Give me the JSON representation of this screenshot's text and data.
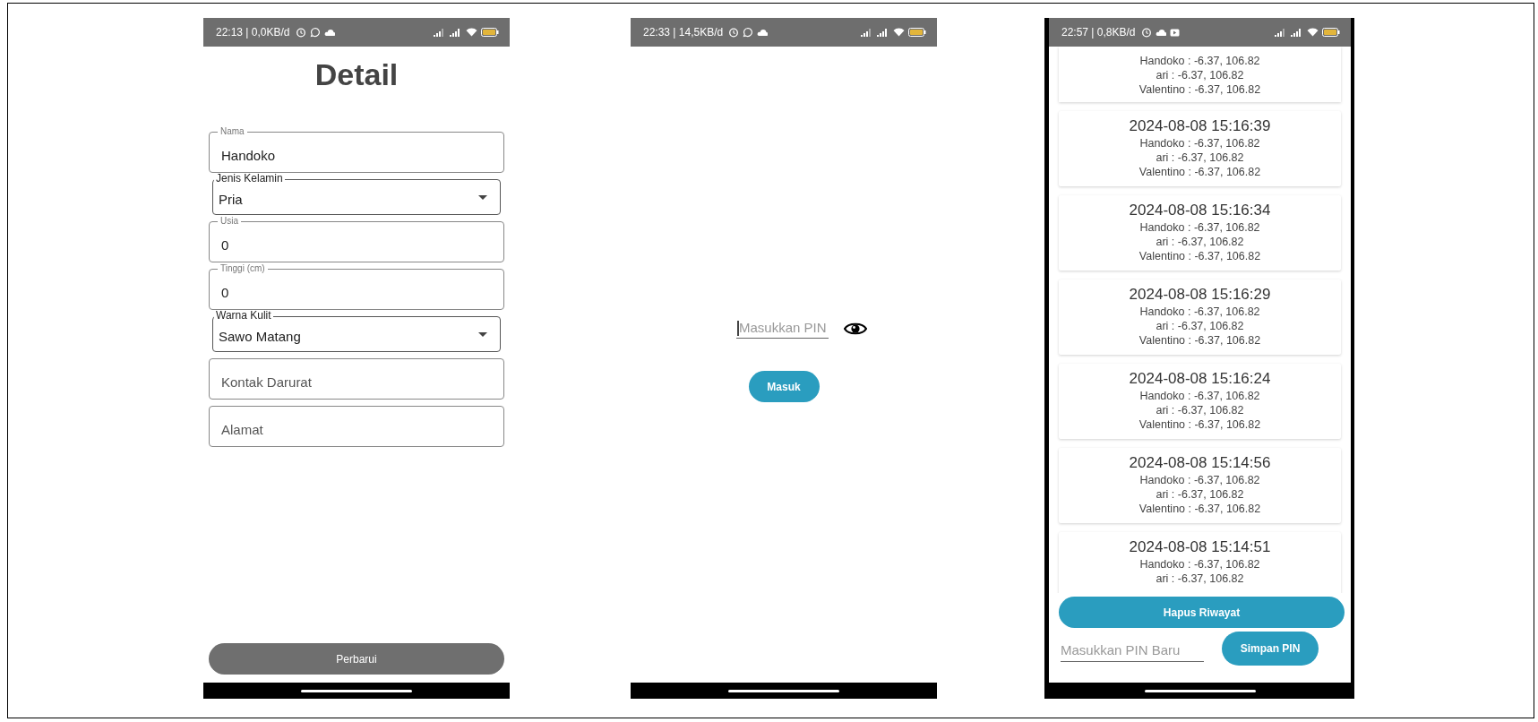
{
  "screens": [
    {
      "kind": "detail",
      "status_bar": {
        "text": "22:13 | 0,0KB/d"
      },
      "title": "Detail",
      "fields": [
        {
          "kind": "text",
          "label": "Nama",
          "value": "Handoko"
        },
        {
          "kind": "dropdown",
          "label": "Jenis Kelamin",
          "value": "Pria"
        },
        {
          "kind": "text",
          "label": "Usia",
          "value": "0"
        },
        {
          "kind": "text",
          "label": "Tinggi (cm)",
          "value": "0"
        },
        {
          "kind": "dropdown",
          "label": "Warna Kulit",
          "value": "Sawo Matang"
        },
        {
          "kind": "text",
          "placeholder": "Kontak Darurat"
        },
        {
          "kind": "text",
          "placeholder": "Alamat"
        }
      ],
      "button": "Perbarui"
    },
    {
      "kind": "pin",
      "status_bar": {
        "text": "22:33 | 14,5KB/d"
      },
      "pin_field": {
        "placeholder": "Masukkan PIN",
        "focused": true
      },
      "button": "Masuk"
    },
    {
      "kind": "history",
      "status_bar": {
        "text": "22:57 | 0,8KB/d"
      },
      "entries": [
        {
          "lines": [
            "Handoko : -6.37, 106.82",
            "ari : -6.37, 106.82",
            "Valentino : -6.37, 106.82"
          ]
        },
        {
          "time": "2024-08-08 15:16:39",
          "lines": [
            "Handoko : -6.37, 106.82",
            "ari : -6.37, 106.82",
            "Valentino : -6.37, 106.82"
          ]
        },
        {
          "time": "2024-08-08 15:16:34",
          "lines": [
            "Handoko : -6.37, 106.82",
            "ari : -6.37, 106.82",
            "Valentino : -6.37, 106.82"
          ]
        },
        {
          "time": "2024-08-08 15:16:29",
          "lines": [
            "Handoko : -6.37, 106.82",
            "ari : -6.37, 106.82",
            "Valentino : -6.37, 106.82"
          ]
        },
        {
          "time": "2024-08-08 15:16:24",
          "lines": [
            "Handoko : -6.37, 106.82",
            "ari : -6.37, 106.82",
            "Valentino : -6.37, 106.82"
          ]
        },
        {
          "time": "2024-08-08 15:14:56",
          "lines": [
            "Handoko : -6.37, 106.82",
            "ari : -6.37, 106.82",
            "Valentino : -6.37, 106.82"
          ]
        },
        {
          "time": "2024-08-08 15:14:51",
          "lines": [
            "Handoko : -6.37, 106.82",
            "ari : -6.37, 106.82"
          ]
        }
      ],
      "clear_button": "Hapus Riwayat",
      "new_pin_field": {
        "placeholder": "Masukkan PIN Baru"
      },
      "save_button": "Simpan PIN"
    }
  ]
}
